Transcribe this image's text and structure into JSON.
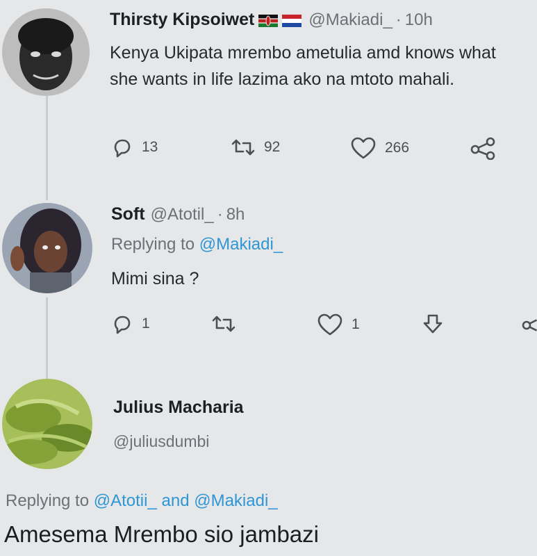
{
  "tweet1": {
    "display_name": "Thirsty Kipsoiwet",
    "handle": "@Makiadi_",
    "separator": "·",
    "time": "10h",
    "text": "Kenya Ukipata mrembo ametulia amd knows what she wants in life lazima ako na mtoto mahali.",
    "replies": "13",
    "retweets": "92",
    "likes": "266"
  },
  "tweet2": {
    "display_name": "Soft",
    "handle": "@Atotil_",
    "separator": "·",
    "time": "8h",
    "replying_prefix": "Replying to",
    "replying_mention": "@Makiadi_",
    "text": "Mimi sina ?",
    "replies": "1",
    "likes": "1"
  },
  "tweet3": {
    "display_name": "Julius Macharia",
    "handle": "@juliusdumbi",
    "replying_prefix": "Replying to",
    "replying_mention_1": "@Atotii_",
    "replying_and": "and",
    "replying_mention_2": "@Makiadi_",
    "text": "Amesema Mrembo sio jambazi"
  },
  "colors": {
    "background": "#e6e7e8",
    "mention": "#2f96d6",
    "muted": "#6b7178"
  },
  "icons": [
    "reply-icon",
    "retweet-icon",
    "like-icon",
    "share-icon"
  ]
}
